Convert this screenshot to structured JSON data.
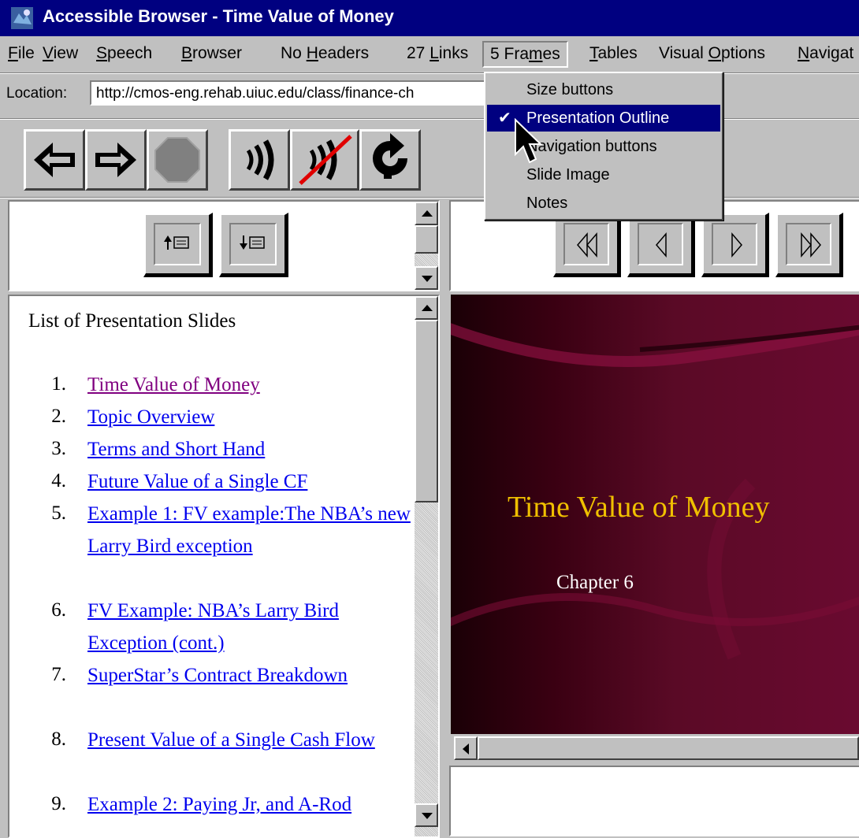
{
  "window": {
    "title": "Accessible Browser - Time Value of Money"
  },
  "menubar": [
    {
      "pre": "",
      "u": "F",
      "post": "ile"
    },
    {
      "pre": "",
      "u": "V",
      "post": "iew"
    },
    {
      "pre": "",
      "u": "S",
      "post": "peech"
    },
    {
      "pre": "",
      "u": "B",
      "post": "rowser"
    },
    {
      "pre": "No ",
      "u": "H",
      "post": "eaders"
    },
    {
      "pre": "27 ",
      "u": "L",
      "post": "inks"
    },
    {
      "pre": "5 Fra",
      "u": "m",
      "post": "es"
    },
    {
      "pre": "",
      "u": "T",
      "post": "ables"
    },
    {
      "pre": "Visual ",
      "u": "O",
      "post": "ptions"
    },
    {
      "pre": "",
      "u": "N",
      "post": "avigat"
    }
  ],
  "location": {
    "label": "Location:",
    "url": "http://cmos-eng.rehab.uiuc.edu/class/finance-ch"
  },
  "toolbar": [
    "back-icon",
    "forward-icon",
    "stop-icon",
    "speak-icon",
    "mute-icon",
    "reload-icon"
  ],
  "frames_menu": {
    "items": [
      {
        "label": "Size buttons",
        "checked": false,
        "selected": false
      },
      {
        "label": "Presentation Outline",
        "checked": true,
        "selected": true
      },
      {
        "label": "Navigation buttons",
        "checked": false,
        "selected": false
      },
      {
        "label": "Slide Image",
        "checked": false,
        "selected": false
      },
      {
        "label": "Notes",
        "checked": false,
        "selected": false
      }
    ]
  },
  "outline": {
    "heading": "List of Presentation Slides",
    "items": [
      {
        "num": "1.",
        "text": "Time Value of Money",
        "visited": true
      },
      {
        "num": "2.",
        "text": "Topic Overview",
        "visited": false
      },
      {
        "num": "3.",
        "text": "Terms and Short Hand",
        "visited": false
      },
      {
        "num": "4.",
        "text": "Future Value of a Single CF",
        "visited": false
      },
      {
        "num": "5.",
        "text": "Example 1: FV example:The NBA’s new Larry Bird exception",
        "visited": false
      },
      {
        "num": "6.",
        "text": "FV Example: NBA’s Larry Bird Exception (cont.)",
        "visited": false
      },
      {
        "num": "7.",
        "text": "SuperStar’s Contract Breakdown",
        "visited": false
      },
      {
        "num": "8.",
        "text": "Present Value of a Single Cash Flow",
        "visited": false
      },
      {
        "num": "9.",
        "text": "Example 2: Paying Jr, and A-Rod",
        "visited": false
      }
    ]
  },
  "slide": {
    "title": "Time Value of Money",
    "subtitle": "Chapter 6"
  },
  "colors": {
    "titlebar": "#000080",
    "link": "#0000ee",
    "visited": "#800080",
    "slide_title": "#f0c000"
  }
}
